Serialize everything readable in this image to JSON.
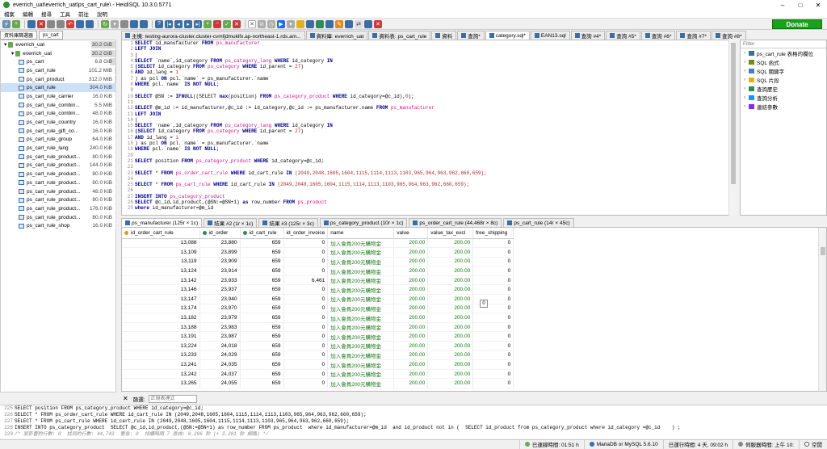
{
  "window": {
    "title": "everrich_uat\\everrich_uat\\ps_cart_rule\\ - HeidiSQL 10.3.0.5771",
    "min": "–",
    "max": "□",
    "close": "✕"
  },
  "menu": [
    "檔案",
    "編輯",
    "搜尋",
    "工具",
    "前往",
    "說明"
  ],
  "donate": "Donate",
  "left_tabs": [
    "資料庫篩選器",
    "ps_cart"
  ],
  "tree": [
    {
      "label": "everrich_uat",
      "size": "30.2 GiB",
      "level": 0,
      "type": "server",
      "bar": 100
    },
    {
      "label": "everrich_uat",
      "size": "30.2 GiB",
      "level": 1,
      "type": "db",
      "bar": 100
    },
    {
      "label": "ps_cart",
      "size": "6.8 GiB",
      "level": 2,
      "type": "table",
      "bar": 22
    },
    {
      "label": "ps_cart_rule",
      "size": "101.2 MiB",
      "level": 2,
      "type": "table",
      "bar": 3
    },
    {
      "label": "ps_cart_product",
      "size": "312.0 MiB",
      "level": 2,
      "type": "table",
      "bar": 5
    },
    {
      "label": "ps_cart_rule",
      "size": "304.0 KiB",
      "level": 2,
      "type": "table",
      "bar": 1,
      "selected": true
    },
    {
      "label": "ps_cart_rule_carrier",
      "size": "16.0 KiB",
      "level": 2,
      "type": "table",
      "bar": 1
    },
    {
      "label": "ps_cart_rule_combin...",
      "size": "5.5 MiB",
      "level": 2,
      "type": "table",
      "bar": 1
    },
    {
      "label": "ps_cart_rule_combin...",
      "size": "48.0 KiB",
      "level": 2,
      "type": "table",
      "bar": 1
    },
    {
      "label": "ps_cart_rule_country",
      "size": "16.0 KiB",
      "level": 2,
      "type": "table",
      "bar": 1
    },
    {
      "label": "ps_cart_rule_gift_co...",
      "size": "16.0 KiB",
      "level": 2,
      "type": "table",
      "bar": 1
    },
    {
      "label": "ps_cart_rule_group",
      "size": "64.0 KiB",
      "level": 2,
      "type": "table",
      "bar": 1
    },
    {
      "label": "ps_cart_rule_lang",
      "size": "240.0 KiB",
      "level": 2,
      "type": "table",
      "bar": 1
    },
    {
      "label": "ps_cart_rule_product...",
      "size": "80.0 KiB",
      "level": 2,
      "type": "table",
      "bar": 1
    },
    {
      "label": "ps_cart_rule_product...",
      "size": "144.0 KiB",
      "level": 2,
      "type": "table",
      "bar": 1
    },
    {
      "label": "ps_cart_rule_product...",
      "size": "80.0 KiB",
      "level": 2,
      "type": "table",
      "bar": 1
    },
    {
      "label": "ps_cart_rule_product...",
      "size": "80.0 KiB",
      "level": 2,
      "type": "table",
      "bar": 1
    },
    {
      "label": "ps_cart_rule_product...",
      "size": "48.0 KiB",
      "level": 2,
      "type": "table",
      "bar": 1
    },
    {
      "label": "ps_cart_rule_product...",
      "size": "80.0 KiB",
      "level": 2,
      "type": "table",
      "bar": 1
    },
    {
      "label": "ps_cart_rule_product...",
      "size": "176.0 KiB",
      "level": 2,
      "type": "table",
      "bar": 1
    },
    {
      "label": "ps_cart_rule_product...",
      "size": "80.0 KiB",
      "level": 2,
      "type": "table",
      "bar": 1
    },
    {
      "label": "ps_cart_rule_shop",
      "size": "16.0 KiB",
      "level": 2,
      "type": "table",
      "bar": 1
    }
  ],
  "tabs": [
    {
      "label": "主機: testing-aurora-cluster.cluster-cvmfjdmuklfx.ap-northeast-1.rds.am...",
      "active": false
    },
    {
      "label": "資料庫: everrich_uat",
      "active": false
    },
    {
      "label": "資料表: ps_cart_rule",
      "active": false
    },
    {
      "label": "資料",
      "active": false
    },
    {
      "label": "查詢*",
      "active": false
    },
    {
      "label": "category.sql*",
      "active": true
    },
    {
      "label": "EAN13.sql",
      "active": false
    },
    {
      "label": "查詢 #4*",
      "active": false
    },
    {
      "label": "查詢 #5*",
      "active": false
    },
    {
      "label": "查詢 #6*",
      "active": false
    },
    {
      "label": "查詢 #7*",
      "active": false
    },
    {
      "label": "查詢 #8*",
      "active": false
    }
  ],
  "editor_lines": [
    [
      {
        "t": "SELECT ",
        "c": "kw"
      },
      {
        "t": "id_manufacturer ",
        "c": ""
      },
      {
        "t": "FROM ",
        "c": "kw"
      },
      {
        "t": "ps_manufacturer",
        "c": "tbl"
      }
    ],
    [
      {
        "t": "LEFT JOIN",
        "c": "kw"
      }
    ],
    [
      {
        "t": "(",
        "c": ""
      }
    ],
    [
      {
        "t": "SELECT ",
        "c": "kw"
      },
      {
        "t": "`name`,id_category ",
        "c": ""
      },
      {
        "t": "FROM ",
        "c": "kw"
      },
      {
        "t": "ps_category_lang ",
        "c": "tbl"
      },
      {
        "t": "WHERE ",
        "c": "kw"
      },
      {
        "t": "id_category ",
        "c": ""
      },
      {
        "t": "IN",
        "c": "kw"
      }
    ],
    [
      {
        "t": "(SELECT ",
        "c": "kw"
      },
      {
        "t": "id_category ",
        "c": ""
      },
      {
        "t": "FROM ",
        "c": "kw"
      },
      {
        "t": "ps_category ",
        "c": "tbl"
      },
      {
        "t": "WHERE ",
        "c": "kw"
      },
      {
        "t": "id_parent = ",
        "c": ""
      },
      {
        "t": "27",
        "c": "num"
      },
      {
        "t": ")",
        "c": ""
      }
    ],
    [
      {
        "t": "AND ",
        "c": "kw"
      },
      {
        "t": "id_lang = ",
        "c": ""
      },
      {
        "t": "1",
        "c": "num"
      }
    ],
    [
      {
        "t": ") as pcl ",
        "c": ""
      },
      {
        "t": "ON ",
        "c": "kw"
      },
      {
        "t": "pcl.`name` = ps_manufacturer.`name`",
        "c": ""
      }
    ],
    [
      {
        "t": "WHERE ",
        "c": "kw"
      },
      {
        "t": "pcl.`name` ",
        "c": ""
      },
      {
        "t": "IS NOT NULL",
        "c": "kw"
      },
      {
        "t": ";",
        "c": ""
      }
    ],
    [],
    [
      {
        "t": "SELECT ",
        "c": "kw"
      },
      {
        "t": "@SN := ",
        "c": ""
      },
      {
        "t": "IFNULL",
        "c": "kw"
      },
      {
        "t": "((SELECT ",
        "c": ""
      },
      {
        "t": "max",
        "c": "kw"
      },
      {
        "t": "(position) ",
        "c": ""
      },
      {
        "t": "FROM ",
        "c": "kw"
      },
      {
        "t": "ps_category_product ",
        "c": "tbl"
      },
      {
        "t": "WHERE ",
        "c": "kw"
      },
      {
        "t": "id_category=@c_id),",
        "c": ""
      },
      {
        "t": "0",
        "c": "num"
      },
      {
        "t": ");",
        "c": ""
      }
    ],
    [],
    [
      {
        "t": "SELECT ",
        "c": "kw"
      },
      {
        "t": "@m_id := id_manufacturer,@c_id := id_category,@c_id := ps_manufacturer.name ",
        "c": ""
      },
      {
        "t": "FROM ",
        "c": "kw"
      },
      {
        "t": "ps_manufacturer",
        "c": "tbl"
      }
    ],
    [
      {
        "t": "LEFT JOIN",
        "c": "kw"
      }
    ],
    [
      {
        "t": "(",
        "c": ""
      }
    ],
    [
      {
        "t": "SELECT ",
        "c": "kw"
      },
      {
        "t": "`name`,id_category ",
        "c": ""
      },
      {
        "t": "FROM ",
        "c": "kw"
      },
      {
        "t": "ps_category_lang ",
        "c": "tbl"
      },
      {
        "t": "WHERE ",
        "c": "kw"
      },
      {
        "t": "id_category ",
        "c": ""
      },
      {
        "t": "IN",
        "c": "kw"
      }
    ],
    [
      {
        "t": "(SELECT ",
        "c": "kw"
      },
      {
        "t": "id_category ",
        "c": ""
      },
      {
        "t": "FROM ",
        "c": "kw"
      },
      {
        "t": "ps_category ",
        "c": "tbl"
      },
      {
        "t": "WHERE ",
        "c": "kw"
      },
      {
        "t": "id_parent = ",
        "c": ""
      },
      {
        "t": "27",
        "c": "num"
      },
      {
        "t": ")",
        "c": ""
      }
    ],
    [
      {
        "t": "AND ",
        "c": "kw"
      },
      {
        "t": "id_lang = ",
        "c": ""
      },
      {
        "t": "1",
        "c": "num"
      }
    ],
    [
      {
        "t": ") as pcl ",
        "c": ""
      },
      {
        "t": "ON ",
        "c": "kw"
      },
      {
        "t": "pcl.`name` = ps_manufacturer.`name`",
        "c": ""
      }
    ],
    [
      {
        "t": "WHERE ",
        "c": "kw"
      },
      {
        "t": "pcl.`name` ",
        "c": ""
      },
      {
        "t": "IS NOT NULL",
        "c": "kw"
      },
      {
        "t": ";",
        "c": ""
      }
    ],
    [],
    [
      {
        "t": "SELECT ",
        "c": "kw"
      },
      {
        "t": "position ",
        "c": ""
      },
      {
        "t": "FROM ",
        "c": "kw"
      },
      {
        "t": "ps_category_product ",
        "c": "tbl"
      },
      {
        "t": "WHERE ",
        "c": "kw"
      },
      {
        "t": "id_category=@c_id;",
        "c": ""
      }
    ],
    [],
    [
      {
        "t": "SELECT ",
        "c": "kw"
      },
      {
        "t": "* ",
        "c": ""
      },
      {
        "t": "FROM ",
        "c": "kw"
      },
      {
        "t": "ps_order_cart_rule ",
        "c": "tbl"
      },
      {
        "t": "WHERE ",
        "c": "kw"
      },
      {
        "t": "id_cart_rule ",
        "c": ""
      },
      {
        "t": "IN ",
        "c": "kw"
      },
      {
        "t": "(2049,2048,1605,1604,1115,1114,1113,1103,965,964,963,962,660,659);",
        "c": "num"
      }
    ],
    [],
    [
      {
        "t": "SELECT ",
        "c": "kw"
      },
      {
        "t": "* ",
        "c": ""
      },
      {
        "t": "FROM ",
        "c": "kw"
      },
      {
        "t": "ps_cart_rule ",
        "c": "tbl"
      },
      {
        "t": "WHERE ",
        "c": "kw"
      },
      {
        "t": "id_cart_rule ",
        "c": ""
      },
      {
        "t": "IN ",
        "c": "kw"
      },
      {
        "t": "(2049,2048,1605,1604,1115,1114,1113,1103,965,964,963,962,660,659);",
        "c": "num"
      }
    ],
    [],
    [
      {
        "t": "INSERT INTO ",
        "c": "kw"
      },
      {
        "t": "ps_category_product",
        "c": "tbl"
      }
    ],
    [
      {
        "t": "SELECT ",
        "c": "kw"
      },
      {
        "t": "@c_id,id_product,(@SN:=@SN+1) ",
        "c": ""
      },
      {
        "t": "as ",
        "c": "kw"
      },
      {
        "t": "row_number ",
        "c": ""
      },
      {
        "t": "FROM ",
        "c": "kw"
      },
      {
        "t": "ps_product",
        "c": "tbl"
      }
    ],
    [
      {
        "t": "where ",
        "c": "kw"
      },
      {
        "t": "id_manufacturer=@m_id",
        "c": ""
      }
    ]
  ],
  "helper": {
    "filter_placeholder": "Filter",
    "items": [
      {
        "label": "ps_cart_rule 表格的欄位",
        "color": "#3a6ea5"
      },
      {
        "label": "SQL 函式",
        "color": "#6b8e23"
      },
      {
        "label": "SQL 關鍵字",
        "color": "#4682b4"
      },
      {
        "label": "SQL 片段",
        "color": "#e0b020"
      },
      {
        "label": "查詢歷史",
        "color": "#2e8b57"
      },
      {
        "label": "查詢分析",
        "color": "#1e90ff"
      },
      {
        "label": "連結參數",
        "color": "#8a2be2"
      }
    ]
  },
  "result_tabs": [
    {
      "label": "ps_manufacturer (125r × 1c)",
      "active": true
    },
    {
      "label": "結果 #2 (1r × 1c)",
      "active": false
    },
    {
      "label": "結果 #3 (125r × 3c)",
      "active": false
    },
    {
      "label": "ps_category_product (10r × 1c)",
      "active": false
    },
    {
      "label": "ps_order_cart_rule (44,468r × 8c)",
      "active": false
    },
    {
      "label": "ps_cart_rule (14r × 45c)",
      "active": false
    }
  ],
  "grid": {
    "columns": [
      {
        "label": "id_order_cart_rule",
        "key": "#d4a017",
        "width": 96
      },
      {
        "label": "id_order",
        "key": "#2e8b57",
        "width": 50
      },
      {
        "label": "id_cart_rule",
        "key": "#2e8b57",
        "width": 54
      },
      {
        "label": "id_order_invoice",
        "key": "",
        "width": 54
      },
      {
        "label": "name",
        "key": "",
        "width": 82
      },
      {
        "label": "value",
        "key": "",
        "width": 42
      },
      {
        "label": "value_tax_excl",
        "key": "",
        "width": 56
      },
      {
        "label": "free_shipping",
        "key": "",
        "width": 50
      }
    ],
    "rows": [
      [
        "13,088",
        "23,880",
        "659",
        "0",
        "加入會員200元購物金",
        "200.00",
        "200.00",
        "0"
      ],
      [
        "13,109",
        "23,899",
        "659",
        "0",
        "加入會員200元購物金",
        "200.00",
        "200.00",
        "0"
      ],
      [
        "13,119",
        "23,909",
        "659",
        "0",
        "加入會員200元購物金",
        "200.00",
        "200.00",
        "0"
      ],
      [
        "13,124",
        "23,914",
        "659",
        "0",
        "加入會員200元購物金",
        "200.00",
        "200.00",
        "0"
      ],
      [
        "13,142",
        "23,933",
        "659",
        "6,461",
        "加入會員200元購物金",
        "200.00",
        "200.00",
        "0"
      ],
      [
        "13,146",
        "23,937",
        "659",
        "0",
        "加入會員200元購物金",
        "200.00",
        "200.00",
        "0"
      ],
      [
        "13,147",
        "23,940",
        "659",
        "0",
        "加入會員200元購物金",
        "200.00",
        "200.00",
        "0"
      ],
      [
        "13,174",
        "23,970",
        "659",
        "0",
        "加入會員200元購物金",
        "200.00",
        "200.00",
        "0"
      ],
      [
        "13,182",
        "23,979",
        "659",
        "0",
        "加入會員200元購物金",
        "200.00",
        "200.00",
        "0"
      ],
      [
        "13,188",
        "23,983",
        "659",
        "0",
        "加入會員200元購物金",
        "200.00",
        "200.00",
        "0"
      ],
      [
        "13,191",
        "23,987",
        "659",
        "0",
        "加入會員200元購物金",
        "200.00",
        "200.00",
        "0"
      ],
      [
        "13,224",
        "24,018",
        "659",
        "0",
        "加入會員200元購物金",
        "200.00",
        "200.00",
        "0"
      ],
      [
        "13,233",
        "24,029",
        "659",
        "0",
        "加入會員200元購物金",
        "200.00",
        "200.00",
        "0"
      ],
      [
        "13,241",
        "24,035",
        "659",
        "0",
        "加入會員200元購物金",
        "200.00",
        "200.00",
        "0"
      ],
      [
        "13,242",
        "24,037",
        "659",
        "0",
        "加入會員200元購物金",
        "200.00",
        "200.00",
        "0"
      ],
      [
        "13,265",
        "24,055",
        "659",
        "0",
        "加入會員200元購物金",
        "200.00",
        "200.00",
        "0"
      ]
    ],
    "tooltip": "0"
  },
  "filter": {
    "label": "篩選:",
    "placeholder": "正規表達式",
    "close": "✕"
  },
  "log": [
    {
      "n": "225",
      "t": "SELECT position FROM ps_category_product WHERE id_category=@c_id;"
    },
    {
      "n": "226",
      "t": "SELECT * FROM ps_order_cart_rule WHERE id_cart_rule IN (2049,2048,1605,1604,1115,1114,1113,1103,965,964,963,962,660,659);"
    },
    {
      "n": "227",
      "t": "SELECT * FROM ps_cart_rule WHERE id_cart_rule IN (2049,2048,1605,1604,1115,1114,1113,1103,965,964,963,962,660,659);"
    },
    {
      "n": "228",
      "t": "INSERT INTO ps_category_product  SELECT @c_id,id_product,(@SN:=@SN+1) as row_number FROM ps_product  where id_manufacturer=@m_id  and id_product not in (  SELECT id_product from ps_category_product where id_category =@c_id    ) ;"
    },
    {
      "n": "229",
      "t": "/* 受影響的行數: 0  找到的行數: 44,743  警告: 0  持續時間 7 查詢: 0.296 秒 (+ 3.281 秒 網路) */",
      "comment": true
    }
  ],
  "status": {
    "connected": "已連線時間: 01:51 h",
    "server": "MariaDB or MySQL 5.6.10",
    "uptime": "已運行時間: 4 天, 09:02 h",
    "server_time": "伺服器時間: 上午 10:",
    "idle": "空閒"
  }
}
